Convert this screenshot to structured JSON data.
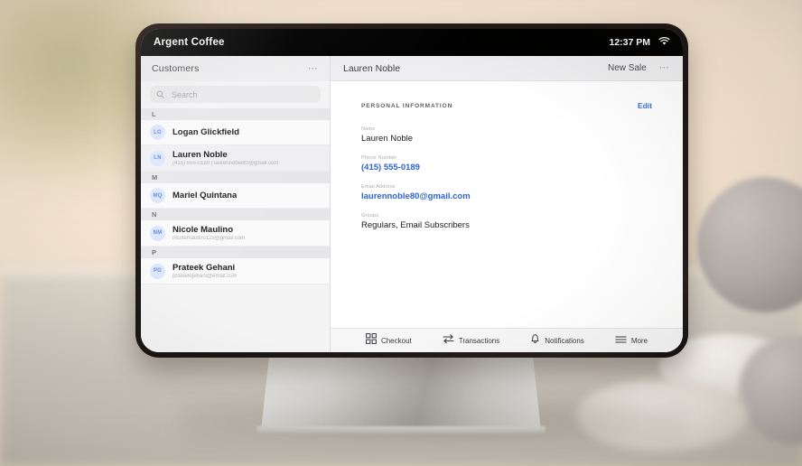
{
  "status_bar": {
    "app_title": "Argent Coffee",
    "time": "12:37 PM",
    "wifi_icon": "wifi-icon"
  },
  "sidebar": {
    "title": "Customers",
    "menu_icon": "ellipsis-icon",
    "search": {
      "placeholder": "Search",
      "value": "",
      "icon": "search-icon"
    },
    "sections": [
      {
        "letter": "L",
        "customers": [
          {
            "initials": "LG",
            "name": "Logan Glickfield",
            "subtitle": "",
            "selected": false
          },
          {
            "initials": "LN",
            "name": "Lauren Noble",
            "subtitle": "(415) 555-0189 | laurennoble80@gmail.com",
            "selected": true
          }
        ]
      },
      {
        "letter": "M",
        "customers": [
          {
            "initials": "MQ",
            "name": "Mariel Quintana",
            "subtitle": "",
            "selected": false
          }
        ]
      },
      {
        "letter": "N",
        "customers": [
          {
            "initials": "NM",
            "name": "Nicole Maulino",
            "subtitle": "nicolemaulino123@gmail.com",
            "selected": false
          }
        ]
      },
      {
        "letter": "P",
        "customers": [
          {
            "initials": "PG",
            "name": "Prateek Gehani",
            "subtitle": "prateekgehani@email.com",
            "selected": false
          }
        ]
      }
    ]
  },
  "detail": {
    "title": "Lauren Noble",
    "new_sale_label": "New Sale",
    "menu_icon": "ellipsis-icon",
    "section_label": "PERSONAL INFORMATION",
    "edit_label": "Edit",
    "fields": [
      {
        "label": "Name",
        "value": "Lauren Noble",
        "is_link": false
      },
      {
        "label": "Phone Number",
        "value": "(415) 555-0189",
        "is_link": true
      },
      {
        "label": "Email Address",
        "value": "laurennoble80@gmail.com",
        "is_link": true
      },
      {
        "label": "Groups",
        "value": "Regulars, Email Subscribers",
        "is_link": false
      }
    ]
  },
  "tabbar": {
    "items": [
      {
        "label": "Checkout",
        "icon": "grid-icon"
      },
      {
        "label": "Transactions",
        "icon": "transfer-arrows-icon"
      },
      {
        "label": "Notifications",
        "icon": "bell-icon"
      },
      {
        "label": "More",
        "icon": "hamburger-icon"
      }
    ]
  },
  "colors": {
    "accent_blue": "#2f62cd",
    "avatar_bg": "#dbe6fb",
    "avatar_text": "#5d86d6",
    "status_bar_bg": "#000000",
    "sidebar_bg": "#f4f4f5"
  }
}
